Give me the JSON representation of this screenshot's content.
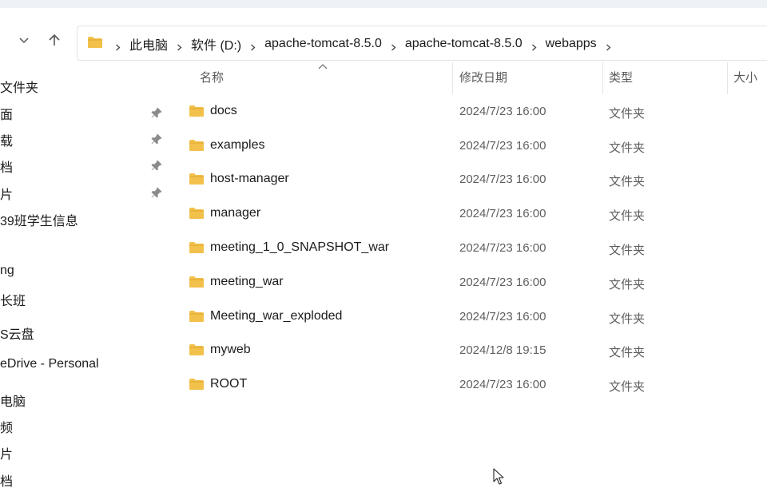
{
  "breadcrumb": {
    "items": [
      "此电脑",
      "软件 (D:)",
      "apache-tomcat-8.5.0",
      "apache-tomcat-8.5.0",
      "webapps"
    ]
  },
  "sidebar": {
    "items": [
      {
        "label": "文件夹",
        "pinned": false
      },
      {
        "label": "面",
        "pinned": true
      },
      {
        "label": "载",
        "pinned": true
      },
      {
        "label": "档",
        "pinned": true
      },
      {
        "label": "片",
        "pinned": true
      },
      {
        "label": "39班学生信息",
        "pinned": false
      },
      {
        "label": "",
        "pinned": false
      },
      {
        "label": "ng",
        "pinned": false
      },
      {
        "label": "长班",
        "pinned": false
      },
      {
        "label": "S云盘",
        "pinned": false
      },
      {
        "label": "eDrive - Personal",
        "pinned": false
      },
      {
        "label": "电脑",
        "pinned": false
      },
      {
        "label": "频",
        "pinned": false
      },
      {
        "label": "片",
        "pinned": false
      },
      {
        "label": "档",
        "pinned": false
      }
    ]
  },
  "columns": {
    "name": "名称",
    "date": "修改日期",
    "type": "类型",
    "size": "大小"
  },
  "files": [
    {
      "name": "docs",
      "date": "2024/7/23 16:00",
      "type": "文件夹"
    },
    {
      "name": "examples",
      "date": "2024/7/23 16:00",
      "type": "文件夹"
    },
    {
      "name": "host-manager",
      "date": "2024/7/23 16:00",
      "type": "文件夹"
    },
    {
      "name": "manager",
      "date": "2024/7/23 16:00",
      "type": "文件夹"
    },
    {
      "name": "meeting_1_0_SNAPSHOT_war",
      "date": "2024/7/23 16:00",
      "type": "文件夹"
    },
    {
      "name": "meeting_war",
      "date": "2024/7/23 16:00",
      "type": "文件夹"
    },
    {
      "name": "Meeting_war_exploded",
      "date": "2024/7/23 16:00",
      "type": "文件夹"
    },
    {
      "name": "myweb",
      "date": "2024/12/8 19:15",
      "type": "文件夹"
    },
    {
      "name": "ROOT",
      "date": "2024/7/23 16:00",
      "type": "文件夹"
    }
  ],
  "colors": {
    "folder": "#f2c14b",
    "folder_dark": "#e0a82c",
    "text": "#1b1b1b",
    "secondary_text": "#5f5f5f"
  }
}
